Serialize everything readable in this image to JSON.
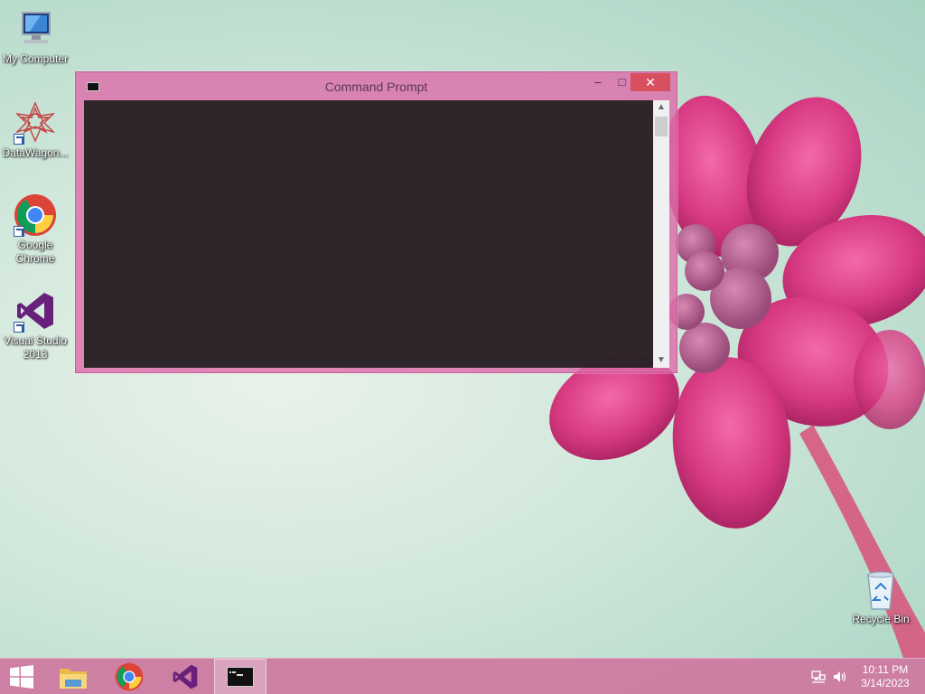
{
  "desktop": {
    "icons": [
      {
        "label": "My Computer",
        "icon": "computer-icon"
      },
      {
        "label": "DataWagon...",
        "icon": "datawagon-icon"
      },
      {
        "label": "Google Chrome",
        "icon": "chrome-icon"
      },
      {
        "label": "Visual Studio 2013",
        "icon": "visual-studio-icon"
      },
      {
        "label": "Recycle Bin",
        "icon": "recycle-bin-icon"
      }
    ]
  },
  "window": {
    "title": "Command Prompt",
    "minimize_glyph": "–",
    "maximize_glyph": "□",
    "close_glyph": "✕",
    "scroll_up_glyph": "▲",
    "scroll_down_glyph": "▼"
  },
  "taskbar": {
    "items": [
      "start-button",
      "file-explorer",
      "google-chrome",
      "visual-studio",
      "command-prompt"
    ],
    "active_item": "command-prompt"
  },
  "clock": {
    "time": "10:11 PM",
    "date": "3/14/2023"
  },
  "colors": {
    "window_frame": "#dd6eaa",
    "close_button": "#d84f5e",
    "console_bg": "#1c1c1c",
    "taskbar": "#ce76a0"
  }
}
